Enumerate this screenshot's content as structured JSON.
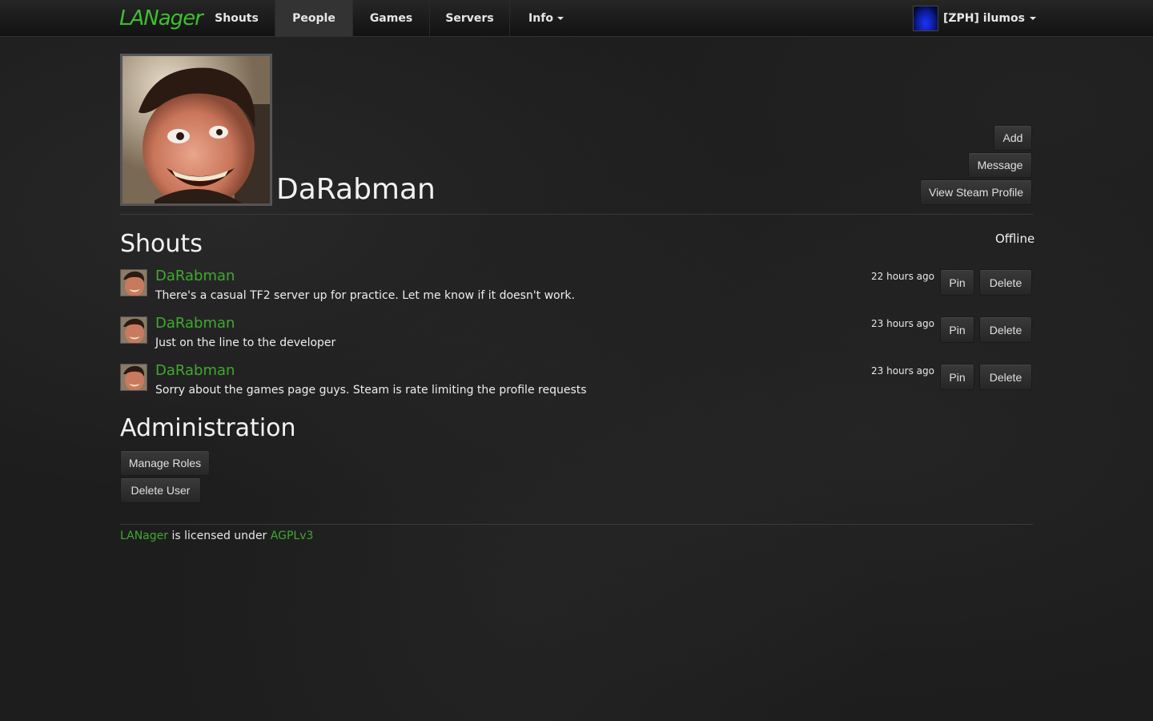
{
  "navbar": {
    "brand": "LANager",
    "items": [
      {
        "label": "Shouts",
        "active": false,
        "dropdown": false
      },
      {
        "label": "People",
        "active": true,
        "dropdown": false
      },
      {
        "label": "Games",
        "active": false,
        "dropdown": false
      },
      {
        "label": "Servers",
        "active": false,
        "dropdown": false
      },
      {
        "label": "Info",
        "active": false,
        "dropdown": true
      }
    ],
    "user": {
      "name": "[ZPH] ilumos",
      "avatar": "blue-portal-avatar"
    }
  },
  "profile": {
    "name": "DaRabman",
    "avatar": "user-photo",
    "actions": {
      "add": "Add",
      "message": "Message",
      "steam": "View Steam Profile"
    },
    "status": "Offline"
  },
  "shouts": {
    "title": "Shouts",
    "items": [
      {
        "author": "DaRabman",
        "text": "There's a casual TF2 server up for practice. Let me know if it doesn't work.",
        "time": "22 hours ago",
        "pin": "Pin",
        "delete": "Delete"
      },
      {
        "author": "DaRabman",
        "text": "Just on the line to the developer",
        "time": "23 hours ago",
        "pin": "Pin",
        "delete": "Delete"
      },
      {
        "author": "DaRabman",
        "text": "Sorry about the games page guys. Steam is rate limiting the profile requests",
        "time": "23 hours ago",
        "pin": "Pin",
        "delete": "Delete"
      }
    ]
  },
  "admin": {
    "title": "Administration",
    "manage_roles": "Manage Roles",
    "delete_user": "Delete User"
  },
  "footer": {
    "app": "LANager",
    "middle": " is licensed under ",
    "license": "AGPLv3"
  },
  "colors": {
    "accent": "#3fa92f",
    "background": "#1d1d1d"
  }
}
